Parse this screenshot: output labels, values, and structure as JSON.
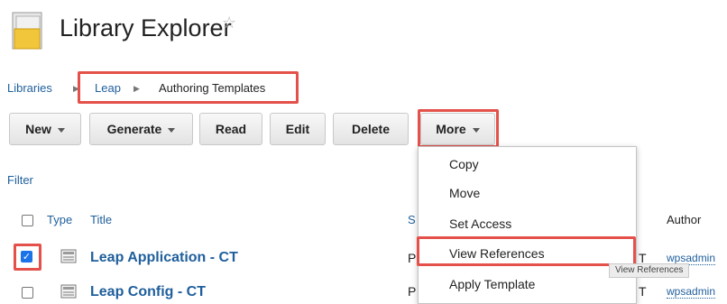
{
  "header": {
    "title": "Library Explorer",
    "favorite_icon": "star-outline-icon",
    "app_icon": "folder-icon"
  },
  "breadcrumb": {
    "root": "Libraries",
    "library": "Leap",
    "current": "Authoring Templates"
  },
  "toolbar": {
    "new": "New",
    "generate": "Generate",
    "read": "Read",
    "edit": "Edit",
    "delete": "Delete",
    "more": "More"
  },
  "filter_label": "Filter",
  "table": {
    "columns": {
      "type": "Type",
      "title": "Title",
      "status": "S",
      "author": "Author"
    },
    "rows": [
      {
        "title": "Leap Application - CT",
        "status": "P",
        "status_end": "T",
        "author": "wpsadmin",
        "checked": true
      },
      {
        "title": "Leap Config - CT",
        "status": "P",
        "status_end": "T",
        "author": "wpsadmin",
        "checked": false
      }
    ]
  },
  "more_menu": {
    "items": [
      "Copy",
      "Move",
      "Set Access",
      "View References",
      "Apply Template"
    ]
  },
  "tooltip": "View References",
  "colors": {
    "link": "#1f5f9c",
    "highlight": "#e4514a",
    "checkbox": "#1a73e8"
  }
}
